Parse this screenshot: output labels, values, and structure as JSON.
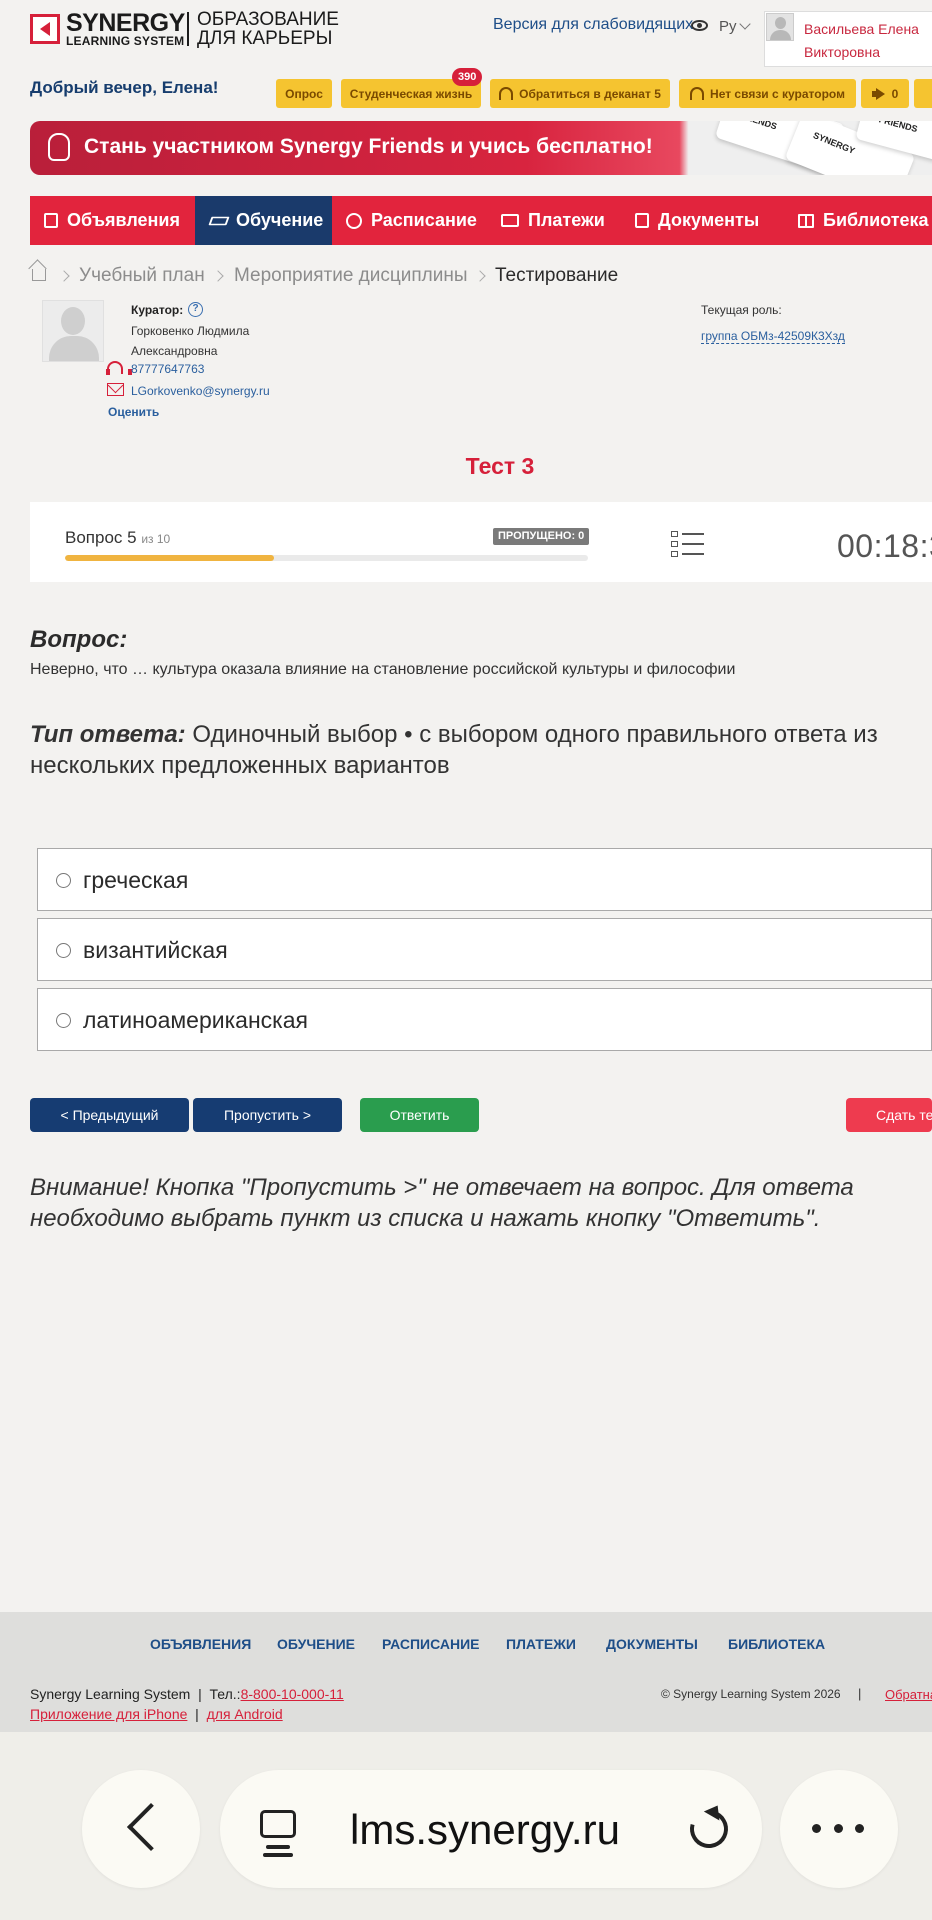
{
  "header": {
    "logo_main": "SYNERGY",
    "logo_sub": "LEARNING SYSTEM",
    "logo_tag_line1": "ОБРАЗОВАНИЕ",
    "logo_tag_line2": "ДЛЯ КАРЬЕРЫ",
    "accessibility_link": "Версия для слабовидящих",
    "language": "Ру",
    "user_name": "Васильева Елена Викторовна"
  },
  "greeting": "Добрый вечер, Елена!",
  "chips": {
    "survey": "Опрос",
    "student_life": "Студенческая жизнь",
    "student_life_count": "390",
    "dean": "Обратиться в деканат 5",
    "curator": "Нет связи с куратором",
    "announcements_count": "0"
  },
  "banner": {
    "text": "Стань участником Synergy Friends и учись бесплатно!",
    "card1": "FRIENDS",
    "card2": "SYNERGY",
    "card3": "FRIENDS"
  },
  "nav": {
    "items": [
      {
        "label": "Объявления"
      },
      {
        "label": "Обучение"
      },
      {
        "label": "Расписание"
      },
      {
        "label": "Платежи"
      },
      {
        "label": "Документы"
      },
      {
        "label": "Библиотека"
      }
    ]
  },
  "breadcrumb": {
    "items": [
      "Учебный план",
      "Мероприятие дисциплины",
      "Тестирование"
    ]
  },
  "curator": {
    "label": "Куратор:",
    "help": "?",
    "name": "Горковенко Людмила Александровна",
    "phone": "87777647763",
    "email": "LGorkovenko@synergy.ru",
    "rate": "Оценить",
    "role_label": "Текущая роль:",
    "role_value": "группа ОБМз-42509К3Хзд"
  },
  "test": {
    "title": "Тест 3",
    "question_label": "Вопрос 5",
    "question_of": "из 10",
    "progress_fraction": 0.4,
    "skipped_badge": "ПРОПУЩЕНО: 0",
    "timer": "00:18:3"
  },
  "question": {
    "heading": "Вопрос:",
    "text": "Неверно, что … культура оказала влияние на становление российской культуры и философии",
    "answer_type_label": "Тип ответа:",
    "answer_type_value": "Одиночный выбор • с выбором одного правильного ответа из нескольких предложенных вариантов",
    "options": [
      {
        "label": "греческая"
      },
      {
        "label": "византийская"
      },
      {
        "label": "латиноамериканская"
      }
    ]
  },
  "buttons": {
    "prev": "< Предыдущий",
    "skip": "Пропустить >",
    "answer": "Ответить",
    "submit": "Сдать тест"
  },
  "warning": "Внимание! Кнопка \"Пропустить >\" не отвечает на вопрос. Для ответа необходимо выбрать пункт из списка и нажать кнопку \"Ответить\".",
  "footer": {
    "links": [
      "ОБЪЯВЛЕНИЯ",
      "ОБУЧЕНИЕ",
      "РАСПИСАНИЕ",
      "ПЛАТЕЖИ",
      "ДОКУМЕНТЫ",
      "БИБЛИОТЕКА"
    ],
    "company": "Synergy Learning System",
    "phone_label": "Тел.:",
    "phone": "8-800-10-000-11",
    "iphone_app": "Приложение для iPhone",
    "android_app": "для Android",
    "copyright": "© Synergy Learning System 2026",
    "feedback": "Обратная связь"
  },
  "browser": {
    "url": "lms.synergy.ru"
  },
  "colors": {
    "brand_red": "#e2243d",
    "brand_navy": "#163c72",
    "chip_yellow": "#f5c430",
    "answer_green": "#2a9d4e"
  }
}
